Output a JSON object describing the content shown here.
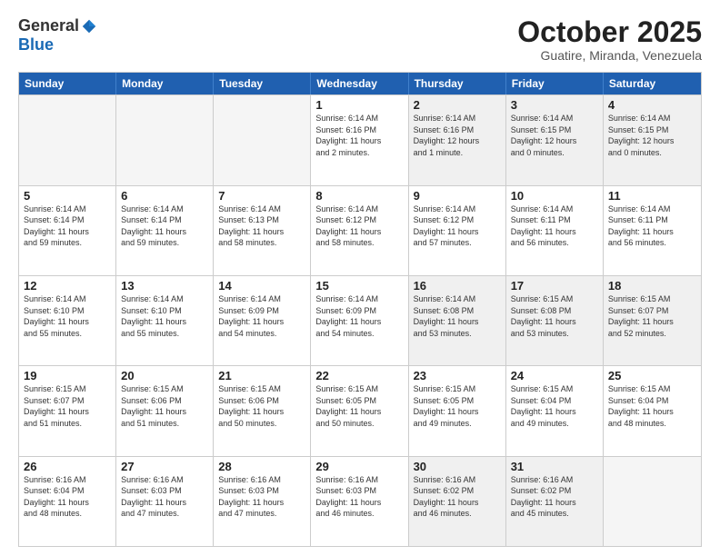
{
  "logo": {
    "general": "General",
    "blue": "Blue"
  },
  "title": "October 2025",
  "subtitle": "Guatire, Miranda, Venezuela",
  "headers": [
    "Sunday",
    "Monday",
    "Tuesday",
    "Wednesday",
    "Thursday",
    "Friday",
    "Saturday"
  ],
  "rows": [
    [
      {
        "day": "",
        "info": "",
        "empty": true
      },
      {
        "day": "",
        "info": "",
        "empty": true
      },
      {
        "day": "",
        "info": "",
        "empty": true
      },
      {
        "day": "1",
        "info": "Sunrise: 6:14 AM\nSunset: 6:16 PM\nDaylight: 11 hours\nand 2 minutes."
      },
      {
        "day": "2",
        "info": "Sunrise: 6:14 AM\nSunset: 6:16 PM\nDaylight: 12 hours\nand 1 minute."
      },
      {
        "day": "3",
        "info": "Sunrise: 6:14 AM\nSunset: 6:15 PM\nDaylight: 12 hours\nand 0 minutes."
      },
      {
        "day": "4",
        "info": "Sunrise: 6:14 AM\nSunset: 6:15 PM\nDaylight: 12 hours\nand 0 minutes."
      }
    ],
    [
      {
        "day": "5",
        "info": "Sunrise: 6:14 AM\nSunset: 6:14 PM\nDaylight: 11 hours\nand 59 minutes."
      },
      {
        "day": "6",
        "info": "Sunrise: 6:14 AM\nSunset: 6:14 PM\nDaylight: 11 hours\nand 59 minutes."
      },
      {
        "day": "7",
        "info": "Sunrise: 6:14 AM\nSunset: 6:13 PM\nDaylight: 11 hours\nand 58 minutes."
      },
      {
        "day": "8",
        "info": "Sunrise: 6:14 AM\nSunset: 6:12 PM\nDaylight: 11 hours\nand 58 minutes."
      },
      {
        "day": "9",
        "info": "Sunrise: 6:14 AM\nSunset: 6:12 PM\nDaylight: 11 hours\nand 57 minutes."
      },
      {
        "day": "10",
        "info": "Sunrise: 6:14 AM\nSunset: 6:11 PM\nDaylight: 11 hours\nand 56 minutes."
      },
      {
        "day": "11",
        "info": "Sunrise: 6:14 AM\nSunset: 6:11 PM\nDaylight: 11 hours\nand 56 minutes."
      }
    ],
    [
      {
        "day": "12",
        "info": "Sunrise: 6:14 AM\nSunset: 6:10 PM\nDaylight: 11 hours\nand 55 minutes."
      },
      {
        "day": "13",
        "info": "Sunrise: 6:14 AM\nSunset: 6:10 PM\nDaylight: 11 hours\nand 55 minutes."
      },
      {
        "day": "14",
        "info": "Sunrise: 6:14 AM\nSunset: 6:09 PM\nDaylight: 11 hours\nand 54 minutes."
      },
      {
        "day": "15",
        "info": "Sunrise: 6:14 AM\nSunset: 6:09 PM\nDaylight: 11 hours\nand 54 minutes."
      },
      {
        "day": "16",
        "info": "Sunrise: 6:14 AM\nSunset: 6:08 PM\nDaylight: 11 hours\nand 53 minutes."
      },
      {
        "day": "17",
        "info": "Sunrise: 6:15 AM\nSunset: 6:08 PM\nDaylight: 11 hours\nand 53 minutes."
      },
      {
        "day": "18",
        "info": "Sunrise: 6:15 AM\nSunset: 6:07 PM\nDaylight: 11 hours\nand 52 minutes."
      }
    ],
    [
      {
        "day": "19",
        "info": "Sunrise: 6:15 AM\nSunset: 6:07 PM\nDaylight: 11 hours\nand 51 minutes."
      },
      {
        "day": "20",
        "info": "Sunrise: 6:15 AM\nSunset: 6:06 PM\nDaylight: 11 hours\nand 51 minutes."
      },
      {
        "day": "21",
        "info": "Sunrise: 6:15 AM\nSunset: 6:06 PM\nDaylight: 11 hours\nand 50 minutes."
      },
      {
        "day": "22",
        "info": "Sunrise: 6:15 AM\nSunset: 6:05 PM\nDaylight: 11 hours\nand 50 minutes."
      },
      {
        "day": "23",
        "info": "Sunrise: 6:15 AM\nSunset: 6:05 PM\nDaylight: 11 hours\nand 49 minutes."
      },
      {
        "day": "24",
        "info": "Sunrise: 6:15 AM\nSunset: 6:04 PM\nDaylight: 11 hours\nand 49 minutes."
      },
      {
        "day": "25",
        "info": "Sunrise: 6:15 AM\nSunset: 6:04 PM\nDaylight: 11 hours\nand 48 minutes."
      }
    ],
    [
      {
        "day": "26",
        "info": "Sunrise: 6:16 AM\nSunset: 6:04 PM\nDaylight: 11 hours\nand 48 minutes."
      },
      {
        "day": "27",
        "info": "Sunrise: 6:16 AM\nSunset: 6:03 PM\nDaylight: 11 hours\nand 47 minutes."
      },
      {
        "day": "28",
        "info": "Sunrise: 6:16 AM\nSunset: 6:03 PM\nDaylight: 11 hours\nand 47 minutes."
      },
      {
        "day": "29",
        "info": "Sunrise: 6:16 AM\nSunset: 6:03 PM\nDaylight: 11 hours\nand 46 minutes."
      },
      {
        "day": "30",
        "info": "Sunrise: 6:16 AM\nSunset: 6:02 PM\nDaylight: 11 hours\nand 46 minutes."
      },
      {
        "day": "31",
        "info": "Sunrise: 6:16 AM\nSunset: 6:02 PM\nDaylight: 11 hours\nand 45 minutes."
      },
      {
        "day": "",
        "info": "",
        "empty": true
      }
    ]
  ]
}
